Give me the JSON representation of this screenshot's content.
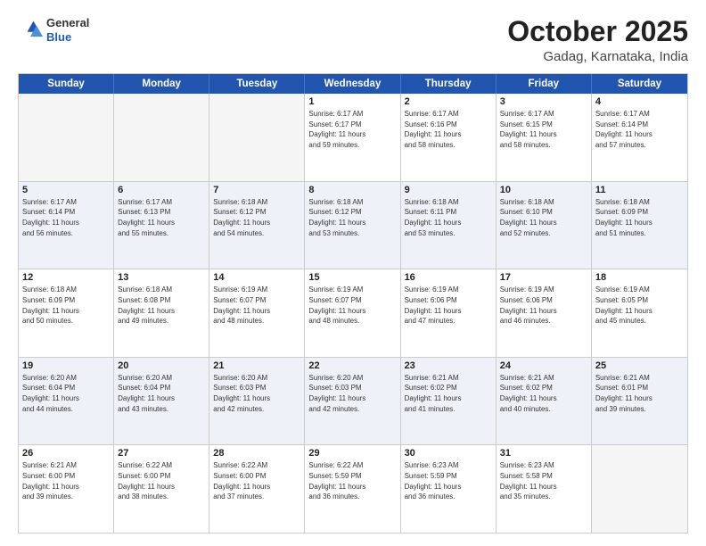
{
  "logo": {
    "general": "General",
    "blue": "Blue"
  },
  "header": {
    "month": "October 2025",
    "location": "Gadag, Karnataka, India"
  },
  "weekdays": [
    "Sunday",
    "Monday",
    "Tuesday",
    "Wednesday",
    "Thursday",
    "Friday",
    "Saturday"
  ],
  "weeks": [
    [
      {
        "day": "",
        "info": ""
      },
      {
        "day": "",
        "info": ""
      },
      {
        "day": "",
        "info": ""
      },
      {
        "day": "1",
        "info": "Sunrise: 6:17 AM\nSunset: 6:17 PM\nDaylight: 11 hours\nand 59 minutes."
      },
      {
        "day": "2",
        "info": "Sunrise: 6:17 AM\nSunset: 6:16 PM\nDaylight: 11 hours\nand 58 minutes."
      },
      {
        "day": "3",
        "info": "Sunrise: 6:17 AM\nSunset: 6:15 PM\nDaylight: 11 hours\nand 58 minutes."
      },
      {
        "day": "4",
        "info": "Sunrise: 6:17 AM\nSunset: 6:14 PM\nDaylight: 11 hours\nand 57 minutes."
      }
    ],
    [
      {
        "day": "5",
        "info": "Sunrise: 6:17 AM\nSunset: 6:14 PM\nDaylight: 11 hours\nand 56 minutes."
      },
      {
        "day": "6",
        "info": "Sunrise: 6:17 AM\nSunset: 6:13 PM\nDaylight: 11 hours\nand 55 minutes."
      },
      {
        "day": "7",
        "info": "Sunrise: 6:18 AM\nSunset: 6:12 PM\nDaylight: 11 hours\nand 54 minutes."
      },
      {
        "day": "8",
        "info": "Sunrise: 6:18 AM\nSunset: 6:12 PM\nDaylight: 11 hours\nand 53 minutes."
      },
      {
        "day": "9",
        "info": "Sunrise: 6:18 AM\nSunset: 6:11 PM\nDaylight: 11 hours\nand 53 minutes."
      },
      {
        "day": "10",
        "info": "Sunrise: 6:18 AM\nSunset: 6:10 PM\nDaylight: 11 hours\nand 52 minutes."
      },
      {
        "day": "11",
        "info": "Sunrise: 6:18 AM\nSunset: 6:09 PM\nDaylight: 11 hours\nand 51 minutes."
      }
    ],
    [
      {
        "day": "12",
        "info": "Sunrise: 6:18 AM\nSunset: 6:09 PM\nDaylight: 11 hours\nand 50 minutes."
      },
      {
        "day": "13",
        "info": "Sunrise: 6:18 AM\nSunset: 6:08 PM\nDaylight: 11 hours\nand 49 minutes."
      },
      {
        "day": "14",
        "info": "Sunrise: 6:19 AM\nSunset: 6:07 PM\nDaylight: 11 hours\nand 48 minutes."
      },
      {
        "day": "15",
        "info": "Sunrise: 6:19 AM\nSunset: 6:07 PM\nDaylight: 11 hours\nand 48 minutes."
      },
      {
        "day": "16",
        "info": "Sunrise: 6:19 AM\nSunset: 6:06 PM\nDaylight: 11 hours\nand 47 minutes."
      },
      {
        "day": "17",
        "info": "Sunrise: 6:19 AM\nSunset: 6:06 PM\nDaylight: 11 hours\nand 46 minutes."
      },
      {
        "day": "18",
        "info": "Sunrise: 6:19 AM\nSunset: 6:05 PM\nDaylight: 11 hours\nand 45 minutes."
      }
    ],
    [
      {
        "day": "19",
        "info": "Sunrise: 6:20 AM\nSunset: 6:04 PM\nDaylight: 11 hours\nand 44 minutes."
      },
      {
        "day": "20",
        "info": "Sunrise: 6:20 AM\nSunset: 6:04 PM\nDaylight: 11 hours\nand 43 minutes."
      },
      {
        "day": "21",
        "info": "Sunrise: 6:20 AM\nSunset: 6:03 PM\nDaylight: 11 hours\nand 42 minutes."
      },
      {
        "day": "22",
        "info": "Sunrise: 6:20 AM\nSunset: 6:03 PM\nDaylight: 11 hours\nand 42 minutes."
      },
      {
        "day": "23",
        "info": "Sunrise: 6:21 AM\nSunset: 6:02 PM\nDaylight: 11 hours\nand 41 minutes."
      },
      {
        "day": "24",
        "info": "Sunrise: 6:21 AM\nSunset: 6:02 PM\nDaylight: 11 hours\nand 40 minutes."
      },
      {
        "day": "25",
        "info": "Sunrise: 6:21 AM\nSunset: 6:01 PM\nDaylight: 11 hours\nand 39 minutes."
      }
    ],
    [
      {
        "day": "26",
        "info": "Sunrise: 6:21 AM\nSunset: 6:00 PM\nDaylight: 11 hours\nand 39 minutes."
      },
      {
        "day": "27",
        "info": "Sunrise: 6:22 AM\nSunset: 6:00 PM\nDaylight: 11 hours\nand 38 minutes."
      },
      {
        "day": "28",
        "info": "Sunrise: 6:22 AM\nSunset: 6:00 PM\nDaylight: 11 hours\nand 37 minutes."
      },
      {
        "day": "29",
        "info": "Sunrise: 6:22 AM\nSunset: 5:59 PM\nDaylight: 11 hours\nand 36 minutes."
      },
      {
        "day": "30",
        "info": "Sunrise: 6:23 AM\nSunset: 5:59 PM\nDaylight: 11 hours\nand 36 minutes."
      },
      {
        "day": "31",
        "info": "Sunrise: 6:23 AM\nSunset: 5:58 PM\nDaylight: 11 hours\nand 35 minutes."
      },
      {
        "day": "",
        "info": ""
      }
    ]
  ]
}
